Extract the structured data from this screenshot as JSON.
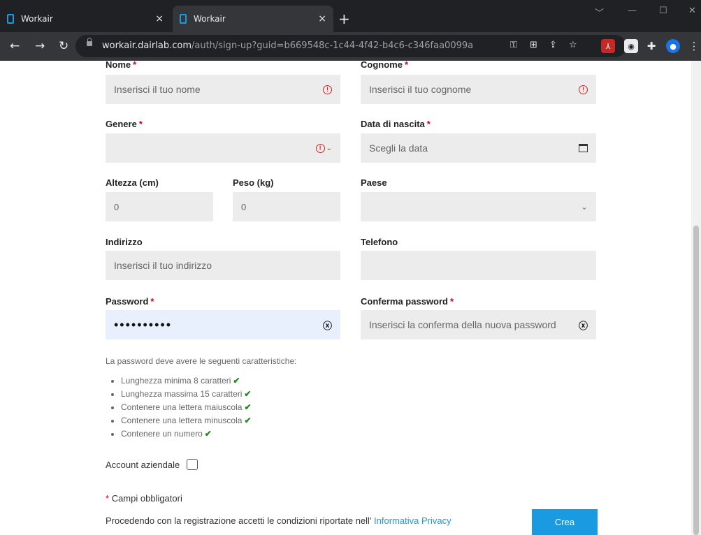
{
  "browser": {
    "tabs": [
      {
        "title": "Workair",
        "close": "×"
      },
      {
        "title": "Workair",
        "close": "×"
      }
    ],
    "new_tab": "+",
    "url_host": "workair.dairlab.com",
    "url_path": "/auth/sign-up?guid=b669548c-1c44-4f42-b4c6-c346faa0099a"
  },
  "form": {
    "nome": {
      "label": "Nome",
      "placeholder": "Inserisci il tuo nome"
    },
    "cognome": {
      "label": "Cognome",
      "placeholder": "Inserisci il tuo cognome"
    },
    "genere": {
      "label": "Genere",
      "value": ""
    },
    "data_nascita": {
      "label": "Data di nascita",
      "placeholder": "Scegli la data"
    },
    "altezza": {
      "label": "Altezza (cm)",
      "value": "0"
    },
    "peso": {
      "label": "Peso (kg)",
      "value": "0"
    },
    "paese": {
      "label": "Paese",
      "value": ""
    },
    "indirizzo": {
      "label": "Indirizzo",
      "placeholder": "Inserisci il tuo indirizzo"
    },
    "telefono": {
      "label": "Telefono",
      "value": ""
    },
    "password": {
      "label": "Password",
      "value": "••••••••••"
    },
    "conferma": {
      "label": "Conferma password",
      "placeholder": "Inserisci la conferma della nuova password"
    },
    "required_mark": "*"
  },
  "rules": {
    "intro": "La password deve avere le seguenti caratteristiche:",
    "items": [
      "Lunghezza minima 8 caratteri",
      "Lunghezza massima 15 caratteri",
      "Contenere una lettera maiuscola",
      "Contenere una lettera minuscola",
      "Contenere un numero"
    ]
  },
  "account_label": "Account aziendale",
  "required_note": "Campi obbligatori",
  "consent": {
    "text": "Procedendo con la registrazione accetti le condizioni riportate nell'",
    "link": "Informativa Privacy"
  },
  "submit_label": "Crea",
  "colors": {
    "accent": "#1a9ae1",
    "required": "#d0021b",
    "valid": "#1b8a1b",
    "error": "#c62828"
  }
}
